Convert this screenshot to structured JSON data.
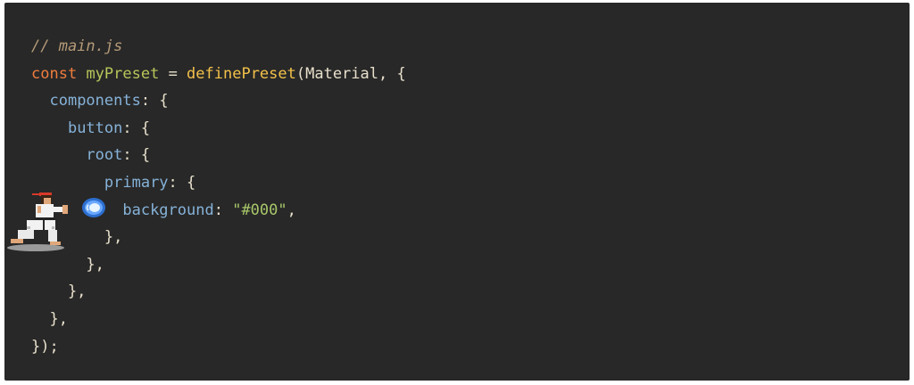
{
  "code": {
    "line1": {
      "comment": "// main.js"
    },
    "line2": {
      "keyword": "const",
      "var": "myPreset",
      "eq": " = ",
      "func": "definePreset",
      "args": "(Material, {"
    },
    "line3": {
      "indent": "  ",
      "prop": "components",
      "punct": ": {"
    },
    "line4": {
      "indent": "    ",
      "prop": "button",
      "punct": ": {"
    },
    "line5": {
      "indent": "      ",
      "prop": "root",
      "punct": ": {"
    },
    "line6": {
      "indent": "        ",
      "prop": "primary",
      "punct": ": {"
    },
    "line7": {
      "indent": "          ",
      "prop": "background",
      "colon": ": ",
      "string": "\"#000\"",
      "end": ","
    },
    "line8": {
      "text": "        },"
    },
    "line9": {
      "text": "      },"
    },
    "line10": {
      "text": "    },"
    },
    "line11": {
      "text": "  },"
    },
    "line12": {
      "text": "});"
    }
  },
  "colors": {
    "background": "#282828",
    "comment": "#b49a78",
    "keyword": "#ef7d3e",
    "variable": "#b9c65a",
    "function": "#f2c14a",
    "property": "#86b2d8",
    "string": "#a8c76a",
    "text": "#e8e0cc"
  },
  "decorations": {
    "fighter_icon": "fighter-sprite-icon",
    "energy_ball_icon": "energy-ball-icon"
  }
}
